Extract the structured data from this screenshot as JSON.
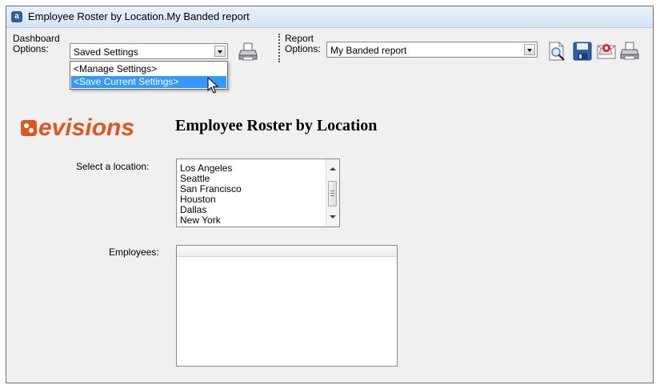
{
  "window": {
    "title": "Employee Roster by Location.My Banded report",
    "app_icon": "a"
  },
  "toolbar": {
    "dashboard_label_line1": "Dashboard",
    "dashboard_label_line2": "Options:",
    "dashboard_combo_value": "Saved Settings",
    "dashboard_dropdown": [
      "<Manage Settings>",
      "<Save Current Settings>"
    ],
    "dashboard_selected_index": 1,
    "report_label_line1": "Report",
    "report_label_line2": "Options:",
    "report_combo_value": "My Banded report",
    "icons": [
      "print-icon",
      "print-preview-icon",
      "save-icon",
      "email-icon",
      "print-icon"
    ]
  },
  "report": {
    "logo_text": "evisions",
    "title": "Employee Roster by Location",
    "location_label": "Select a location:",
    "locations": [
      "Los Angeles",
      "Seattle",
      "San Francisco",
      "Houston",
      "Dallas",
      "New York"
    ],
    "employees_label": "Employees:"
  },
  "colors": {
    "brand_orange": "#e0561f",
    "brand_navy": "#1a2c55",
    "selection_blue": "#3399ff"
  }
}
